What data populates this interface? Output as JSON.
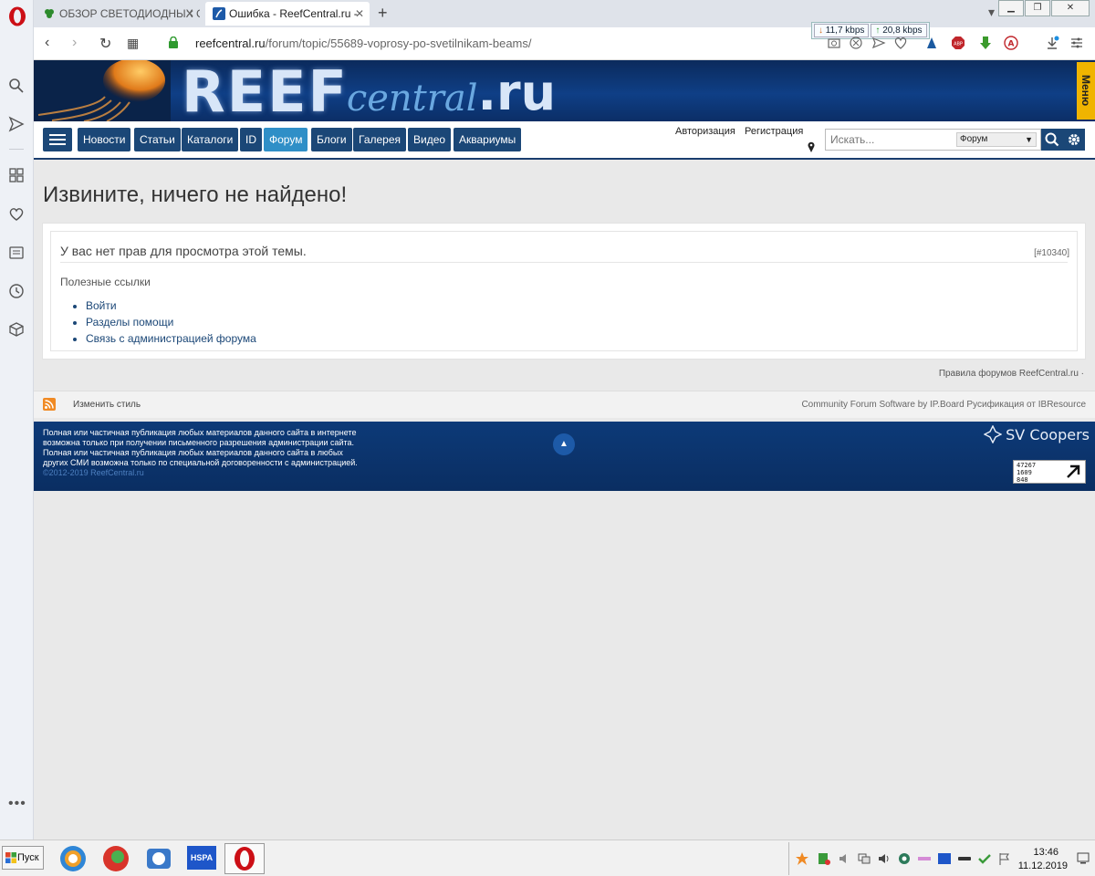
{
  "browser": {
    "tabs": [
      {
        "title": "ОБЗОР СВЕТОДИОДНЫХ С"
      },
      {
        "title": "Ошибка - ReefCentral.ru -"
      }
    ],
    "new_tab": "+",
    "url_host": "reefcentral.ru",
    "url_path": "/forum/topic/55689-voprosy-po-svetilnikam-beams/",
    "speed_down": "11,7 kbps",
    "speed_up": "20,8 kbps"
  },
  "site": {
    "logo_reef": "REEF",
    "logo_central": "central",
    "logo_ru": ".ru",
    "menu_tab": "Меню",
    "nav": [
      "Новости",
      "Статьи",
      "Каталоги",
      "ID",
      "Форум",
      "Блоги",
      "Галерея",
      "Видео",
      "Аквариумы"
    ],
    "nav_active": "Форум",
    "login": "Авторизация",
    "register": "Регистрация",
    "search_placeholder": "Искать...",
    "search_scope": "Форум"
  },
  "content": {
    "title": "Извините, ничего не найдено!",
    "error_text": "У вас нет прав для просмотра этой темы.",
    "error_code": "[#10340]",
    "useful_title": "Полезные ссылки",
    "useful_links": [
      "Войти",
      "Разделы помощи",
      "Связь с администрацией форума"
    ],
    "forum_rules": "Правила форумов ReefCentral.ru ·"
  },
  "footer": {
    "change_style": "Изменить стиль",
    "credit": "Community Forum Software by IP.Board Русификация от IBResource",
    "notice_1": "Полная или частичная публикация любых материалов данного сайта в интернете",
    "notice_2": "возможна только при получении письменного разрешения администрации сайта.",
    "notice_3": "Полная или частичная публикация любых материалов данного сайта в любых",
    "notice_4": "других СМИ возможна только по специальной договоренности с администрацией.",
    "copyright": "©2012-2019 ReefCentral.ru",
    "sv": "SV Coopers",
    "counter_1": "47267",
    "counter_2": "1609",
    "counter_3": "848"
  },
  "taskbar": {
    "start": "Пуск",
    "hspa": "HSPA",
    "time": "13:46",
    "date": "11.12.2019"
  },
  "colors": {
    "nav_bg": "#1b4777",
    "nav_active": "#2f8fc7",
    "header_bg": "#0f3f86",
    "menu_tab": "#f0b400",
    "link": "#1b4777"
  }
}
